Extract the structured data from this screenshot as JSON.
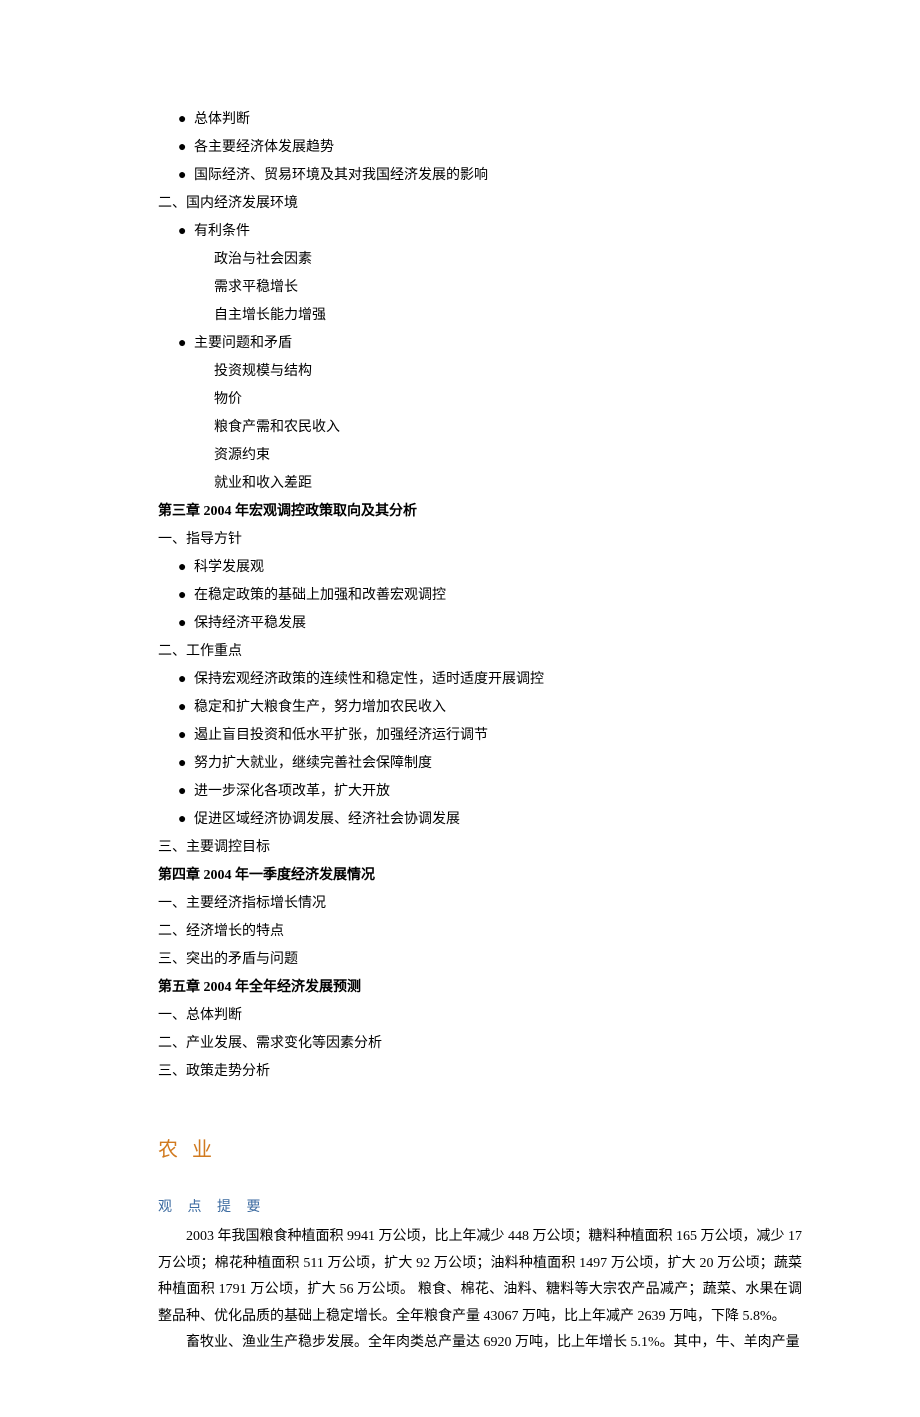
{
  "toc": {
    "pre_bullets": [
      "总体判断",
      "各主要经济体发展趋势",
      "国际经济、贸易环境及其对我国经济发展的影响"
    ],
    "sec2_title": "二、国内经济发展环境",
    "sec2_b1": "有利条件",
    "sec2_b1_items": [
      "政治与社会因素",
      "需求平稳增长",
      "自主增长能力增强"
    ],
    "sec2_b2": "主要问题和矛盾",
    "sec2_b2_items": [
      "投资规模与结构",
      "物价",
      "粮食产需和农民收入",
      "资源约束",
      "就业和收入差距"
    ],
    "ch3": "第三章  2004 年宏观调控政策取向及其分析",
    "ch3_s1": "一、指导方针",
    "ch3_s1_bullets": [
      "科学发展观",
      "在稳定政策的基础上加强和改善宏观调控",
      "保持经济平稳发展"
    ],
    "ch3_s2": "二、工作重点",
    "ch3_s2_bullets": [
      "保持宏观经济政策的连续性和稳定性，适时适度开展调控",
      "稳定和扩大粮食生产，努力增加农民收入",
      "遏止盲目投资和低水平扩张，加强经济运行调节",
      "努力扩大就业，继续完善社会保障制度",
      "进一步深化各项改革，扩大开放",
      "促进区域经济协调发展、经济社会协调发展"
    ],
    "ch3_s3": "三、主要调控目标",
    "ch4": "第四章    2004 年一季度经济发展情况",
    "ch4_items": [
      "一、主要经济指标增长情况",
      "二、经济增长的特点",
      "三、突出的矛盾与问题"
    ],
    "ch5": "第五章  2004 年全年经济发展预测",
    "ch5_items": [
      "一、总体判断",
      "二、产业发展、需求变化等因素分析",
      "三、政策走势分析"
    ]
  },
  "agri": {
    "heading": "农业",
    "sub": "观 点 提 要",
    "p1": "2003 年我国粮食种植面积 9941 万公顷，比上年减少 448 万公顷；糖料种植面积 165 万公顷，减少 17 万公顷；棉花种植面积 511 万公顷，扩大 92 万公顷；油料种植面积 1497 万公顷，扩大 20 万公顷；蔬菜种植面积 1791 万公顷，扩大 56 万公顷。 粮食、棉花、油料、糖料等大宗农产品减产；蔬菜、水果在调整品种、优化品质的基础上稳定增长。全年粮食产量 43067 万吨，比上年减产 2639 万吨，下降 5.8%。",
    "p2": "畜牧业、渔业生产稳步发展。全年肉类总产量达 6920 万吨，比上年增长 5.1%。其中，牛、羊肉产量"
  }
}
